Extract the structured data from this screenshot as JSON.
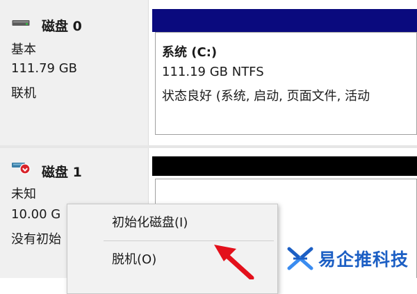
{
  "disks": [
    {
      "title": "磁盘 0",
      "type": "基本",
      "size": "111.79 GB",
      "status": "联机",
      "header_color": "#0a0a7e",
      "volume": {
        "name": "系统 (C:)",
        "size_fs": "111.19 GB NTFS",
        "health": "状态良好 (系统, 启动, 页面文件, 活动"
      }
    },
    {
      "title": "磁盘 1",
      "type": "未知",
      "size": "10.00 G",
      "status": "没有初始",
      "header_color": "#000000"
    }
  ],
  "context_menu": {
    "items": [
      {
        "label": "初始化磁盘(I)"
      },
      {
        "label": "脱机(O)"
      }
    ]
  },
  "annotation": {
    "arrow_color": "#e3101b"
  },
  "watermark": {
    "text": "易企推科技",
    "color": "#1c5fc4"
  }
}
